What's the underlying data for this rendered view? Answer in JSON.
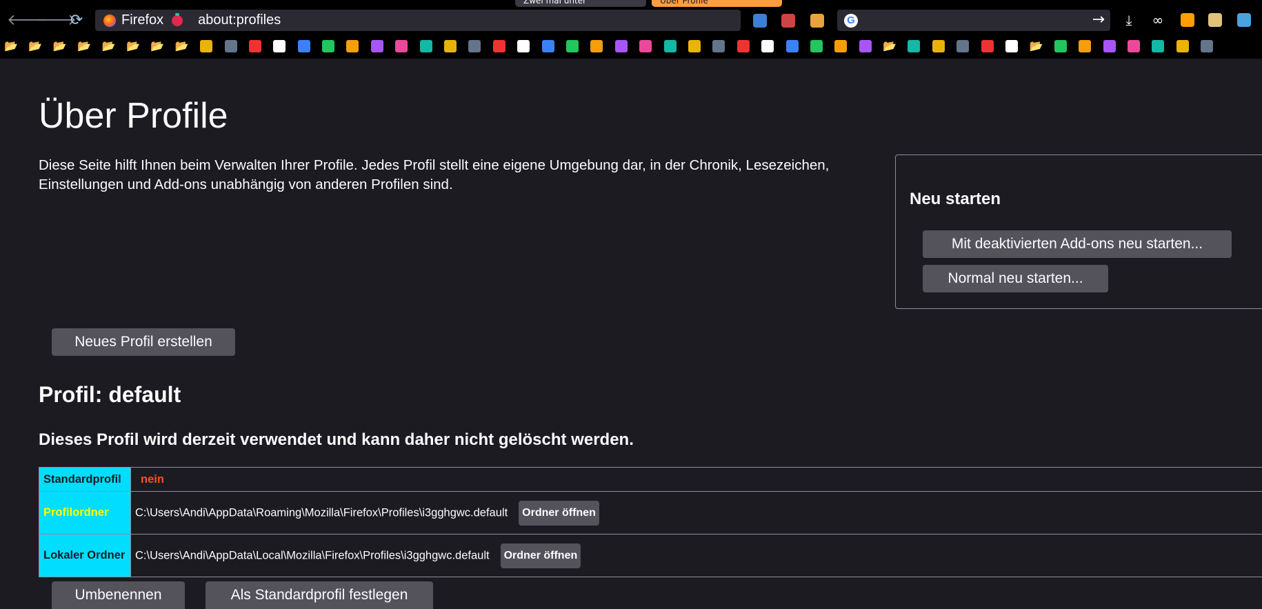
{
  "browser": {
    "tabs": [
      {
        "label": "Zwei mal unter"
      },
      {
        "label": "Über Profile"
      }
    ],
    "identity_label": "Firefox",
    "url": "about:profiles",
    "colors": {
      "chrome_bg": "#000000",
      "urlbar_bg": "#2b2a33",
      "active_tab": "#ff9e3d"
    }
  },
  "bookmarks_toolbar": {
    "count": 50
  },
  "page": {
    "title": "Über Profile",
    "intro": "Diese Seite hilft Ihnen beim Verwalten Ihrer Profile. Jedes Profil stellt eine eigene Umgebung dar, in der Chronik, Lesezeichen, Einstellungen und Add-ons unabhängig von anderen Profilen sind.",
    "restart": {
      "heading": "Neu starten",
      "addons_disabled_button": "Mit deaktivierten Add-ons neu starten...",
      "normal_button": "Normal neu starten..."
    },
    "create_profile_button": "Neues Profil erstellen",
    "profile": {
      "heading": "Profil: default",
      "in_use_note": "Dieses Profil wird derzeit verwendet und kann daher nicht gelöscht werden.",
      "rows": {
        "default_label": "Standardprofil",
        "default_value": "nein",
        "folder_label": "Profilordner",
        "folder_path": "C:\\Users\\Andi\\AppData\\Roaming\\Mozilla\\Firefox\\Profiles\\i3gghgwc.default",
        "local_label": "Lokaler Ordner",
        "local_path": "C:\\Users\\Andi\\AppData\\Local\\Mozilla\\Firefox\\Profiles\\i3gghgwc.default",
        "open_folder_button": "Ordner öffnen"
      },
      "rename_button": "Umbenennen",
      "set_default_button": "Als Standardprofil festlegen"
    },
    "colors": {
      "accent_cyan": "#00ddff",
      "page_bg": "#1c1b22",
      "button_bg": "#54535c",
      "warn_red": "#ff4f1f",
      "label_yellow": "#ffff00"
    }
  }
}
